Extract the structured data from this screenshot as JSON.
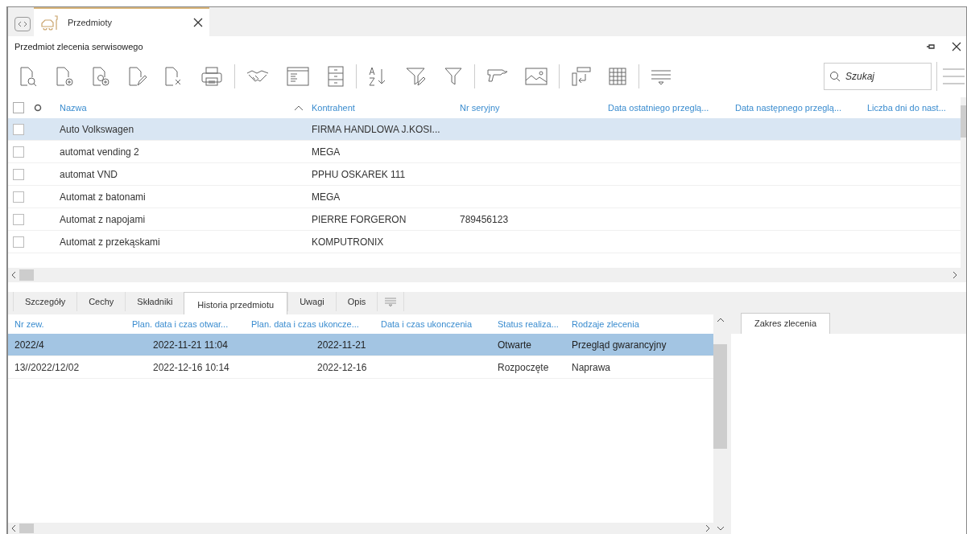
{
  "doc_tab": {
    "label": "Przedmioty",
    "selected": true
  },
  "panel": {
    "title": "Przedmiot zlecenia serwisowego"
  },
  "search": {
    "placeholder": "Szukaj"
  },
  "grid": {
    "select_all_checked": false,
    "columns": [
      "Nazwa",
      "Kontrahent",
      "Nr seryjny",
      "Data ostatniego przeglą...",
      "Data następnego przeglą...",
      "Liczba dni do nast..."
    ],
    "rows": [
      {
        "cells": [
          "Auto Volkswagen",
          "FIRMA HANDLOWA J.KOSI...",
          "",
          "",
          "",
          ""
        ],
        "selected": true,
        "checked": false
      },
      {
        "cells": [
          "automat vending 2",
          "MEGA",
          "",
          "",
          "",
          ""
        ],
        "selected": false,
        "checked": false
      },
      {
        "cells": [
          "automat VND",
          "PPHU OSKAREK 111",
          "",
          "",
          "",
          ""
        ],
        "selected": false,
        "checked": false
      },
      {
        "cells": [
          "Automat z batonami",
          "MEGA",
          "",
          "",
          "",
          ""
        ],
        "selected": false,
        "checked": false
      },
      {
        "cells": [
          "Automat z napojami",
          "PIERRE FORGERON",
          "789456123",
          "",
          "",
          ""
        ],
        "selected": false,
        "checked": false
      },
      {
        "cells": [
          "Automat z przekąskami",
          "KOMPUTRONIX",
          "",
          "",
          "",
          ""
        ],
        "selected": false,
        "checked": false
      }
    ]
  },
  "detail_tabs": [
    {
      "label": "Szczegóły",
      "selected": false
    },
    {
      "label": "Cechy",
      "selected": false
    },
    {
      "label": "Składniki",
      "selected": false
    },
    {
      "label": "Historia przedmiotu",
      "selected": true
    },
    {
      "label": "Uwagi",
      "selected": false
    },
    {
      "label": "Opis",
      "selected": false
    }
  ],
  "history": {
    "columns": [
      "Nr zew.",
      "Plan. data i czas otwar...",
      "Plan. data i czas ukoncze...",
      "Data i czas ukonczenia",
      "Status realiza...",
      "Rodzaje zlecenia"
    ],
    "rows": [
      {
        "cells": [
          "2022/4",
          "2022-11-21 11:04",
          "2022-11-21",
          "",
          "Otwarte",
          "Przegląd gwarancyjny"
        ],
        "selected": true
      },
      {
        "cells": [
          "13//2022/12/02",
          "2022-12-16 10:14",
          "2022-12-16",
          "",
          "Rozpoczęte",
          "Naprawa"
        ],
        "selected": false
      }
    ]
  },
  "side_tab": {
    "label": "Zakres zlecenia",
    "selected": true
  }
}
